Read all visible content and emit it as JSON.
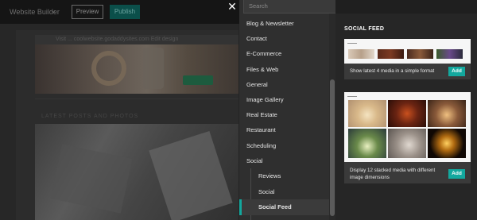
{
  "background": {
    "app_title": "Website Builder",
    "preview_label": "Preview",
    "publish_label": "Publish",
    "url_text": "Visit ... coolwebsite.godaddysites.com   Edit design",
    "faint_caption": "LATEST POSTS AND PHOTOS"
  },
  "panel": {
    "search_placeholder": "Search",
    "categories": [
      {
        "label": "Blog & Newsletter"
      },
      {
        "label": "Contact"
      },
      {
        "label": "E-Commerce"
      },
      {
        "label": "Files & Web"
      },
      {
        "label": "General"
      },
      {
        "label": "Image Gallery"
      },
      {
        "label": "Real Estate"
      },
      {
        "label": "Restaurant"
      },
      {
        "label": "Scheduling"
      },
      {
        "label": "Social"
      }
    ],
    "sub_items": [
      {
        "label": "Reviews"
      },
      {
        "label": "Social"
      },
      {
        "label": "Social Feed",
        "active": true
      }
    ]
  },
  "preview": {
    "section_title": "SOCIAL FEED",
    "cards": [
      {
        "description": "Show latest 4 media in a simple format",
        "add_label": "Add"
      },
      {
        "description": "Display 12 stacked media with different image dimensions",
        "add_label": "Add"
      }
    ]
  },
  "colors": {
    "accent": "#13a89e",
    "panel_bg": "#2f2f2f",
    "preview_bg": "#262626"
  }
}
